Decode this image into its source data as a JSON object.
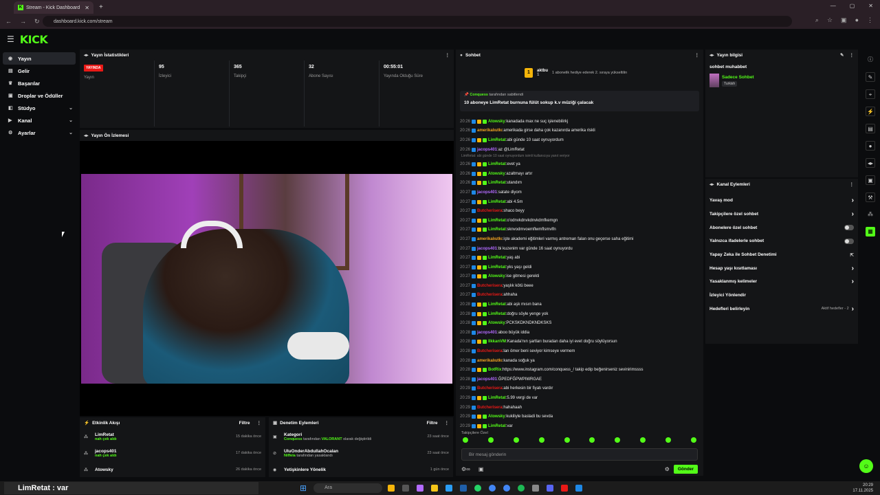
{
  "browser": {
    "tab_title": "Stream - Kick Dashboard",
    "url": "dashboard.kick.com/stream"
  },
  "logo": "KICK",
  "sidebar": {
    "items": [
      {
        "label": "Yayın",
        "icon": "broadcast-icon",
        "active": true,
        "chev": false
      },
      {
        "label": "Gelir",
        "icon": "wallet-icon",
        "active": false,
        "chev": false
      },
      {
        "label": "Başarılar",
        "icon": "trophy-icon",
        "active": false,
        "chev": false
      },
      {
        "label": "Droplar ve Ödüller",
        "icon": "gift-icon",
        "active": false,
        "chev": false
      },
      {
        "label": "Stüdyo",
        "icon": "studio-icon",
        "active": false,
        "chev": true
      },
      {
        "label": "Kanal",
        "icon": "channel-icon",
        "active": false,
        "chev": true
      },
      {
        "label": "Ayarlar",
        "icon": "gear-icon",
        "active": false,
        "chev": true
      }
    ]
  },
  "stats": {
    "title": "Yayın İstatistikleri",
    "live_badge": "YAYINDA",
    "items": [
      {
        "value": "",
        "label": "Yayın"
      },
      {
        "value": "95",
        "label": "İzleyici"
      },
      {
        "value": "365",
        "label": "Takipçi"
      },
      {
        "value": "32",
        "label": "Abone Sayısı"
      },
      {
        "value": "00:55:01",
        "label": "Yayında Olduğu Süre"
      }
    ]
  },
  "preview": {
    "title": "Yayın Ön İzlemesi"
  },
  "chat": {
    "title": "Sohbet",
    "top_user": "aktbu",
    "top_count": "1",
    "top_msg": "1 abonelik hediye ederek 2. sıraya yükseltilin",
    "pinned_by_name": "Conquess",
    "pinned_by_suffix": "tarafından sabitlendi",
    "pinned_text": "10 aboneye LimRetat burnuna fülüt sokup k.v müziği çalacak",
    "messages": [
      {
        "t": "20:26",
        "u": "Atowsky",
        "c": "#53fc18",
        "x": "kanadada max ne suç işlenebilirkj"
      },
      {
        "t": "20:26",
        "u": "amerikalıutkı",
        "c": "#f5a623",
        "x": "amerikada girse daha çok kazanırda amerika riskli"
      },
      {
        "t": "20:26",
        "u": "LimRetat",
        "c": "#53fc18",
        "x": "abi günde 10 saat oynuyordum"
      },
      {
        "t": "20:26",
        "u": "jacops401",
        "c": "#b36bff",
        "x": "az @LimRetat"
      },
      {
        "t": "20:26",
        "u": "LimRetat",
        "c": "#53fc18",
        "x": "evet ya",
        "reply": "LimRetat: abi günde 10 saat oynuyordum isimli kullanıcıya yanıt veriyor"
      },
      {
        "t": "20:26",
        "u": "Atowsky",
        "c": "#53fc18",
        "x": "azaltmayı artır"
      },
      {
        "t": "20:26",
        "u": "LimRetat",
        "c": "#53fc18",
        "x": "utandım"
      },
      {
        "t": "20:27",
        "u": "jacops401",
        "c": "#b36bff",
        "x": "satate diyom"
      },
      {
        "t": "20:27",
        "u": "LimRetat",
        "c": "#53fc18",
        "x": "abi 4.5m"
      },
      {
        "t": "20:27",
        "u": "Butcherisera",
        "c": "#e91916",
        "x": "shaco beyy"
      },
      {
        "t": "20:27",
        "u": "LimRetat",
        "c": "#53fc18",
        "x": "o'odnvkdnvkdnvkdmfkemgn"
      },
      {
        "t": "20:27",
        "u": "LimRetat",
        "c": "#53fc18",
        "x": "sknvodmvoemflwmflsmvlfn"
      },
      {
        "t": "20:27",
        "u": "amerikalıutkı",
        "c": "#f5a623",
        "x": "işte akademi eğitimleri varmış antreman falan onu geçerse saha eğitimi"
      },
      {
        "t": "20:27",
        "u": "jacops401",
        "c": "#b36bff",
        "x": "bi kuzenim var günde 16 saat oynuyordu"
      },
      {
        "t": "20:27",
        "u": "LimRetat",
        "c": "#53fc18",
        "x": "yaş abi"
      },
      {
        "t": "20:27",
        "u": "LimRetat",
        "c": "#53fc18",
        "x": "yks yaşı geldi"
      },
      {
        "t": "20:27",
        "u": "Atowsky",
        "c": "#53fc18",
        "x": "ise gitmesi gerekti"
      },
      {
        "t": "20:27",
        "u": "Butcherisera",
        "c": "#e91916",
        "x": "yaşlık kötü beee"
      },
      {
        "t": "20:27",
        "u": "Butcherisera",
        "c": "#e91916",
        "x": "ahhaha"
      },
      {
        "t": "20:28",
        "u": "LimRetat",
        "c": "#53fc18",
        "x": "abi aşk mısın bana"
      },
      {
        "t": "20:28",
        "u": "LimRetat",
        "c": "#53fc18",
        "x": "doğru söyle yenge yok"
      },
      {
        "t": "20:28",
        "u": "Atowsky",
        "c": "#53fc18",
        "x": "PCKSKDKNDKNDKSKS"
      },
      {
        "t": "20:28",
        "u": "jacops401",
        "c": "#b36bff",
        "x": "aboo büyük iddia"
      },
      {
        "t": "20:28",
        "u": "IlkkanVM",
        "c": "#53fc18",
        "x": "Kanada'nın şartları buradan daha iyi evet doğru söylüyorsun"
      },
      {
        "t": "20:28",
        "u": "Butcherisera",
        "c": "#e91916",
        "x": "lan ömer beni seviyor kimseye vermem"
      },
      {
        "t": "20:28",
        "u": "amerikalıutkı",
        "c": "#f5a623",
        "x": "kanada soğuk ya"
      },
      {
        "t": "20:28",
        "u": "BotRix",
        "c": "#53fc18",
        "x": "https://www.instagram.com/conquess_/ takip edip beğenirseniz sevinirimssss"
      },
      {
        "t": "20:28",
        "u": "jacops401",
        "c": "#b36bff",
        "x": "ĞPEDFĞPWPIWRGAE"
      },
      {
        "t": "20:29",
        "u": "Butcherisera",
        "c": "#e91916",
        "x": "abi herkesin bir fiyatı vardır"
      },
      {
        "t": "20:29",
        "u": "LimRetat",
        "c": "#53fc18",
        "x": "5.99 vergi de var"
      },
      {
        "t": "20:29",
        "u": "Butcherisera",
        "c": "#e91916",
        "x": "hahahaah"
      },
      {
        "t": "20:29",
        "u": "Atowsky",
        "c": "#53fc18",
        "x": "kukiliyle basladi bu sevda"
      },
      {
        "t": "20:29",
        "u": "LimRetat",
        "c": "#53fc18",
        "x": "var"
      }
    ],
    "followers_only": "Takipçilere Özel",
    "placeholder": "Bir mesaj gönderin",
    "send_label": "Gönder"
  },
  "stream_info": {
    "title": "Yayın bilgisi",
    "stream_title": "sohbet muhabbet",
    "category": "Sadece Sohbet",
    "language": "Turkish"
  },
  "channel_actions": {
    "title": "Kanal Eylemleri",
    "items": [
      {
        "label": "Yavaş mod",
        "kind": "chev"
      },
      {
        "label": "Takipçilere özel sohbet",
        "kind": "chev"
      },
      {
        "label": "Abonelere özel sohbet",
        "kind": "toggle"
      },
      {
        "label": "Yalnızca ifadelerle sohbet",
        "kind": "toggle"
      },
      {
        "label": "Yapay Zeka ile Sohbet Denetimi",
        "kind": "ext"
      },
      {
        "label": "Hesap yaşı kısıtlaması",
        "kind": "chev"
      },
      {
        "label": "Yasaklanmış kelimeler",
        "kind": "chev"
      },
      {
        "label": "İzleyici Yönlendir",
        "kind": "none"
      },
      {
        "label": "Hedefleri belirleyin",
        "kind": "goal",
        "extra": "Aktif hedefler - 2"
      }
    ]
  },
  "activity": {
    "title": "Etkinlik Akışı",
    "filter": "Filtre",
    "items": [
      {
        "name": "LimRetat",
        "action": "nah çek aldı",
        "time": "15 dakika önce"
      },
      {
        "name": "jacops401",
        "action": "nah çek aldı",
        "time": "17 dakika önce"
      },
      {
        "name": "Atowsky",
        "action": "",
        "time": "26 dakika önce"
      }
    ]
  },
  "moderation": {
    "title": "Denetim Eylemleri",
    "filter": "Filtre",
    "items": [
      {
        "name": "Kategori",
        "who": "Conquess",
        "mid": "tarafından",
        "target": "VALORANT",
        "rest": "olarak değiştirildi",
        "time": "23 saat önce"
      },
      {
        "name": "UluOnderAbdullahOcalan",
        "who": "Niffela",
        "mid": "tarafından yasaklandı",
        "target": "",
        "rest": "",
        "time": "23 saat önce"
      },
      {
        "name": "Yetişkinlere Yönelik",
        "who": "",
        "mid": "",
        "target": "",
        "rest": "",
        "time": "1 gün önce"
      }
    ]
  },
  "taskbar": {
    "label": "LimRetat : var",
    "search": "Ara",
    "time": "20:29",
    "date": "17.11.2025"
  },
  "colors": {
    "accent": "#53fc18",
    "live": "#e91916",
    "bg": "#0b0c0e",
    "panel": "#141517"
  }
}
